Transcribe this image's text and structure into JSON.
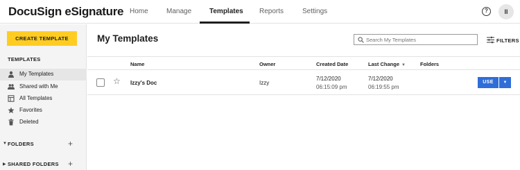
{
  "app": {
    "logo": "DocuSign eSignature"
  },
  "nav": {
    "items": [
      {
        "label": "Home"
      },
      {
        "label": "Manage"
      },
      {
        "label": "Templates",
        "active": true
      },
      {
        "label": "Reports"
      },
      {
        "label": "Settings"
      }
    ],
    "help_icon": "?",
    "avatar_initials": "II"
  },
  "sidebar": {
    "create_button": "CREATE TEMPLATE",
    "section_title": "TEMPLATES",
    "items": [
      {
        "label": "My Templates",
        "icon": "person-icon",
        "active": true
      },
      {
        "label": "Shared with Me",
        "icon": "people-icon"
      },
      {
        "label": "All Templates",
        "icon": "template-icon"
      },
      {
        "label": "Favorites",
        "icon": "star-icon"
      },
      {
        "label": "Deleted",
        "icon": "trash-icon"
      }
    ],
    "groups": [
      {
        "label": "FOLDERS"
      },
      {
        "label": "SHARED FOLDERS"
      }
    ]
  },
  "main": {
    "title": "My Templates",
    "search_placeholder": "Search My Templates",
    "filters_label": "FILTERS",
    "columns": {
      "name": "Name",
      "owner": "Owner",
      "created": "Created Date",
      "last_change": "Last Change",
      "folders": "Folders"
    },
    "sort_indicator": "▼",
    "rows": [
      {
        "name": "Izzy's Doc",
        "owner": "Izzy",
        "created_date": "7/12/2020",
        "created_time": "06:15:09 pm",
        "changed_date": "7/12/2020",
        "changed_time": "06:19:55 pm",
        "folders": "",
        "use_label": "USE",
        "use_caret": "▼"
      }
    ]
  },
  "colors": {
    "accent_yellow": "#ffcc22",
    "primary_blue": "#2f6ed8"
  }
}
